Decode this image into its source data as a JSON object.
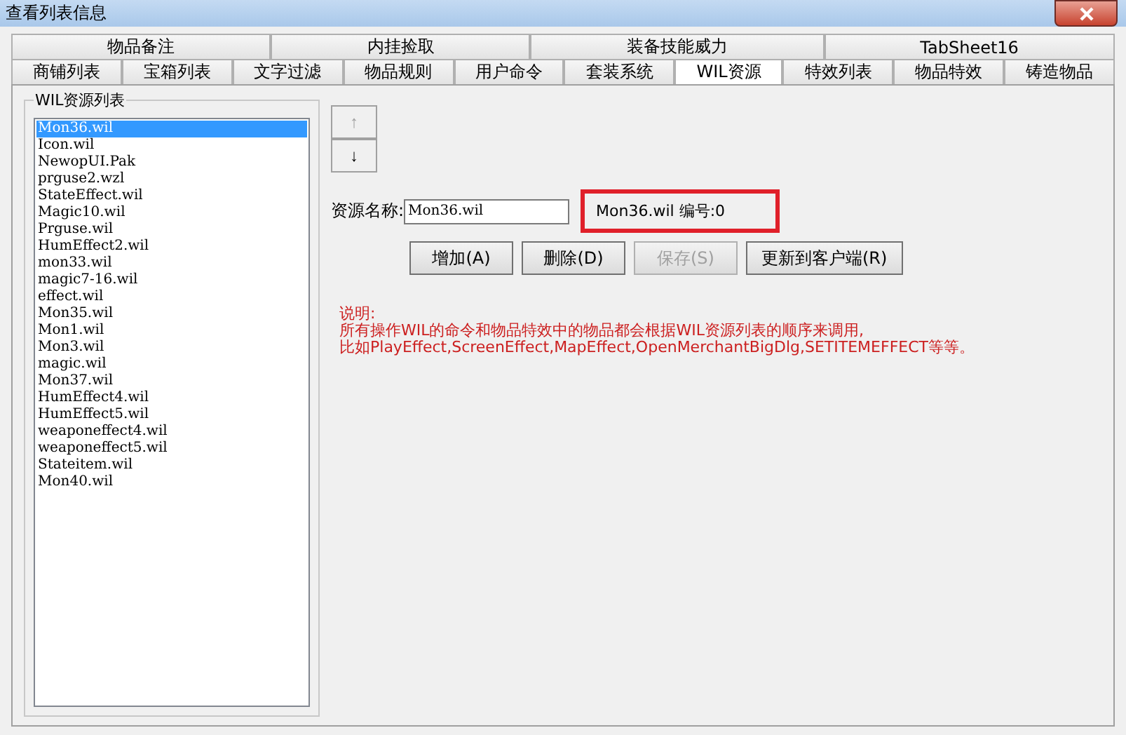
{
  "window": {
    "title": "查看列表信息"
  },
  "tab_rows": [
    [
      {
        "label": "物品备注",
        "selected": false
      },
      {
        "label": "内挂捡取",
        "selected": false
      },
      {
        "label": "装备技能威力",
        "selected": false
      },
      {
        "label": "TabSheet16",
        "selected": false
      }
    ],
    [
      {
        "label": "商铺列表",
        "selected": false
      },
      {
        "label": "宝箱列表",
        "selected": false
      },
      {
        "label": "文字过滤",
        "selected": false
      },
      {
        "label": "物品规则",
        "selected": false
      },
      {
        "label": "用户命令",
        "selected": false
      },
      {
        "label": "套装系统",
        "selected": false
      },
      {
        "label": "WIL资源",
        "selected": true
      },
      {
        "label": "特效列表",
        "selected": false
      },
      {
        "label": "物品特效",
        "selected": false
      },
      {
        "label": "铸造物品",
        "selected": false
      }
    ]
  ],
  "resource_group": {
    "title": "WIL资源列表",
    "items": [
      {
        "label": "Mon36.wil",
        "selected": true
      },
      {
        "label": "Icon.wil",
        "selected": false
      },
      {
        "label": "NewopUI.Pak",
        "selected": false
      },
      {
        "label": "prguse2.wzl",
        "selected": false
      },
      {
        "label": "StateEffect.wil",
        "selected": false
      },
      {
        "label": "Magic10.wil",
        "selected": false
      },
      {
        "label": "Prguse.wil",
        "selected": false
      },
      {
        "label": "HumEffect2.wil",
        "selected": false
      },
      {
        "label": "mon33.wil",
        "selected": false
      },
      {
        "label": "magic7-16.wil",
        "selected": false
      },
      {
        "label": "effect.wil",
        "selected": false
      },
      {
        "label": "Mon35.wil",
        "selected": false
      },
      {
        "label": "Mon1.wil",
        "selected": false
      },
      {
        "label": "Mon3.wil",
        "selected": false
      },
      {
        "label": "magic.wil",
        "selected": false
      },
      {
        "label": "Mon37.wil",
        "selected": false
      },
      {
        "label": "HumEffect4.wil",
        "selected": false
      },
      {
        "label": "HumEffect5.wil",
        "selected": false
      },
      {
        "label": "weaponeffect4.wil",
        "selected": false
      },
      {
        "label": "weaponeffect5.wil",
        "selected": false
      },
      {
        "label": "Stateitem.wil",
        "selected": false
      },
      {
        "label": "Mon40.wil",
        "selected": false
      }
    ]
  },
  "move_buttons": [
    {
      "label": "↑",
      "disabled": true
    },
    {
      "label": "↓",
      "disabled": false
    }
  ],
  "name_field": {
    "label": "资源名称:",
    "value": "Mon36.wil"
  },
  "info_label": "Mon36.wil 编号:0",
  "buttons": [
    {
      "label": "增加(A)",
      "disabled": false
    },
    {
      "label": "删除(D)",
      "disabled": false
    },
    {
      "label": "保存(S)",
      "disabled": true
    },
    {
      "label": "更新到客户端(R)",
      "disabled": false
    }
  ],
  "notes": [
    "说明:",
    "所有操作WIL的命令和物品特效中的物品都会根据WIL资源列表的顺序来调用,",
    "比如PlayEffect,ScreenEffect,MapEffect,OpenMerchantBigDlg,SETITEMEFFECT等等。"
  ]
}
